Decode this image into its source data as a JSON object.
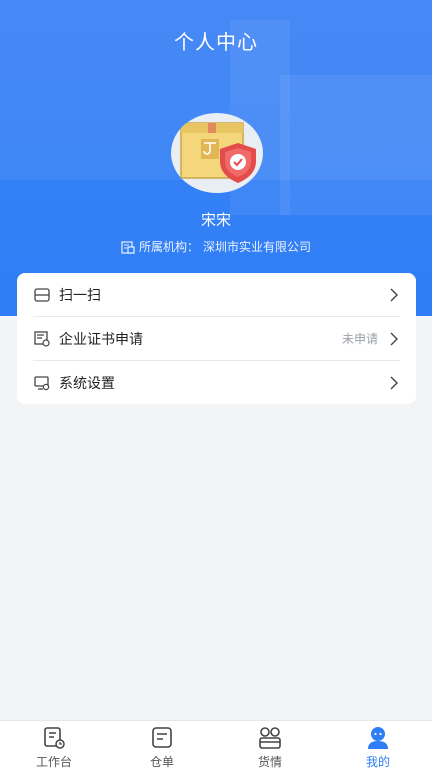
{
  "header": {
    "title": "个人中心",
    "background_color": "#2f7ef6"
  },
  "profile": {
    "name": "宋宋",
    "org_label": "所属机构：",
    "org_name": "深圳市实业有限公司"
  },
  "menu": {
    "items": [
      {
        "label": "扫一扫",
        "status": "",
        "icon": "scan-card-icon"
      },
      {
        "label": "企业证书申请",
        "status": "未申请",
        "icon": "certificate-icon"
      },
      {
        "label": "系统设置",
        "status": "",
        "icon": "settings-monitor-icon"
      }
    ]
  },
  "tabbar": {
    "active_color": "#2f7ef6",
    "tabs": [
      {
        "label": "工作台",
        "icon": "workbench-icon"
      },
      {
        "label": "仓单",
        "icon": "warehouse-receipt-icon"
      },
      {
        "label": "货情",
        "icon": "goods-status-icon"
      },
      {
        "label": "我的",
        "icon": "profile-icon",
        "active": true
      }
    ]
  }
}
